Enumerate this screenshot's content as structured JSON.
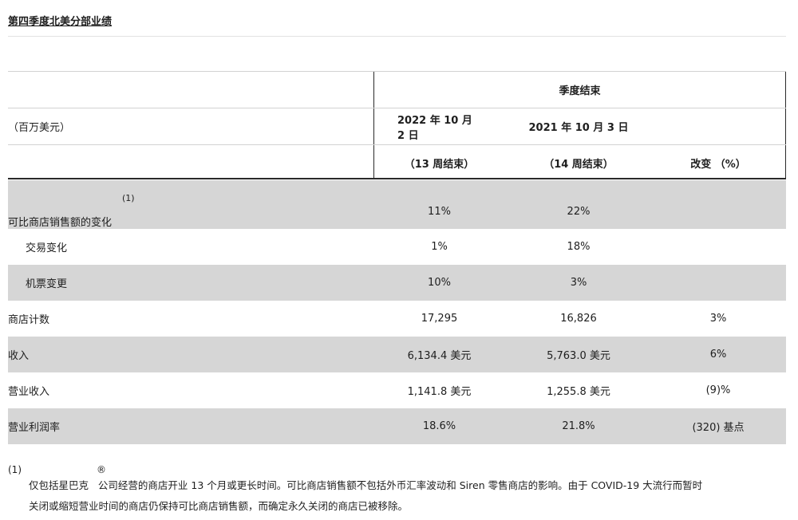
{
  "title": "第四季度北美分部业绩",
  "header": {
    "group_label": "季度结束",
    "unit_label": "（百万美元）",
    "col1_date": "2022 年 10 月 2 日",
    "col2_date": "2021 年 10 月 3 日",
    "col1_weeks": "（13 周结束）",
    "col2_weeks": "（14 周结束）",
    "col3_label": "改变 （%）"
  },
  "rows": [
    {
      "label": "可比商店销售额的变化",
      "footnote": "(1)",
      "v1": "11%",
      "v2": "22%",
      "v3": ""
    },
    {
      "label": "交易变化",
      "v1": "1%",
      "v2": "18%",
      "v3": ""
    },
    {
      "label": "机票变更",
      "v1": "10%",
      "v2": "3%",
      "v3": ""
    },
    {
      "label": "商店计数",
      "v1": "17,295",
      "v2": "16,826",
      "v3": "3%"
    },
    {
      "label": "收入",
      "v1": "6,134.4 美元",
      "v2": "5,763.0 美元",
      "v3": "6%"
    },
    {
      "label": "营业收入",
      "v1": "1,141.8 美元",
      "v2": "1,255.8 美元",
      "v3": "(9)%"
    },
    {
      "label": "营业利润率",
      "v1": "18.6%",
      "v2": "21.8%",
      "v3": "(320) 基点"
    }
  ],
  "footnote": {
    "mark": "(1)",
    "registered": "®",
    "line1": "仅包括星巴克   公司经营的商店开业 13 个月或更长时间。可比商店销售额不包括外币汇率波动和 Siren 零售商店的影响。由于 COVID-19 大流行而暂时",
    "line2": "关闭或缩短营业时间的商店仍保持可比商店销售额，而确定永久关闭的商店已被移除。"
  }
}
